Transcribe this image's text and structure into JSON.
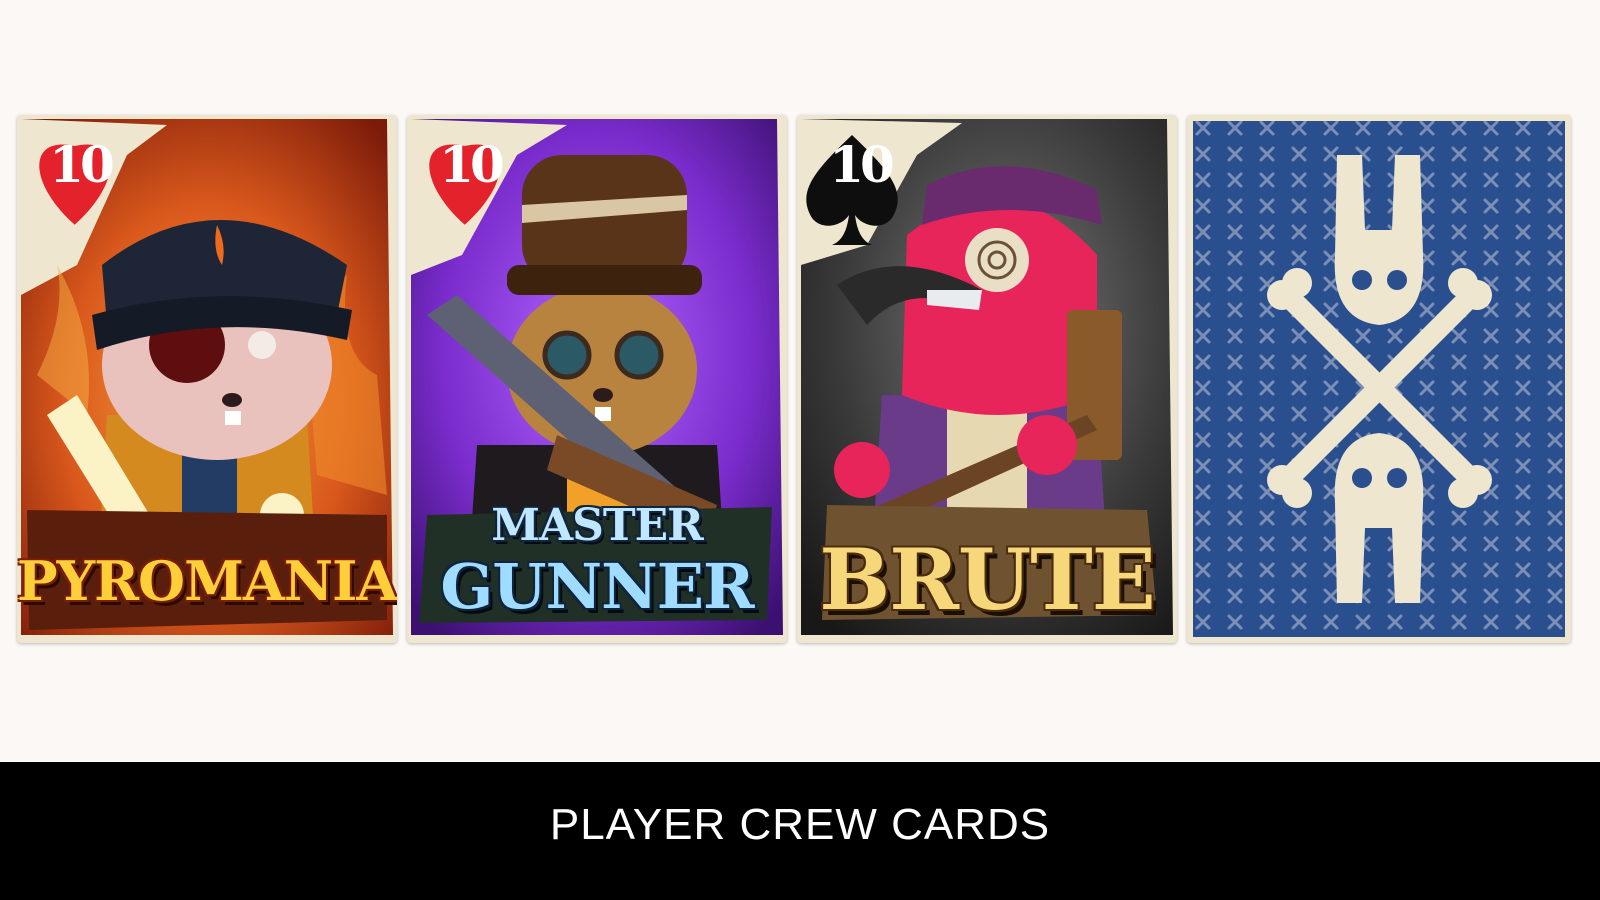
{
  "cards": [
    {
      "rank": "10",
      "suit": "heart",
      "suit_color": "#e4222b",
      "title": "PYROMANIAC",
      "background": "#d9581c"
    },
    {
      "rank": "10",
      "suit": "heart",
      "suit_color": "#e4222b",
      "title_line1": "MASTER",
      "title_line2": "GUNNER",
      "background": "#7a2ccc"
    },
    {
      "rank": "10",
      "suit": "spade",
      "suit_color": "#0e0e0e",
      "title": "BRUTE",
      "background": "#3a3a3a"
    },
    {
      "face": "back",
      "pattern_color": "#2a4f8e",
      "emblem": "rabbit-skull-crossbones-icon"
    }
  ],
  "caption": "PLAYER CREW CARDS"
}
